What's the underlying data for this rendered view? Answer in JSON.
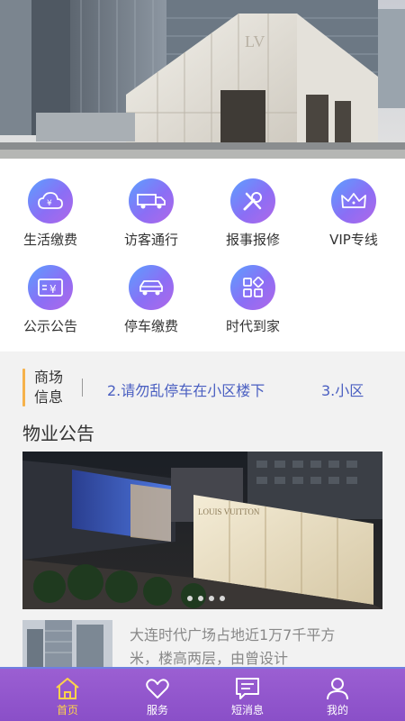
{
  "services": [
    {
      "label": "生活缴费",
      "icon": "cloud-yen-icon"
    },
    {
      "label": "访客通行",
      "icon": "truck-icon"
    },
    {
      "label": "报事报修",
      "icon": "tools-icon"
    },
    {
      "label": "VIP专线",
      "icon": "crown-icon"
    },
    {
      "label": "公示公告",
      "icon": "yen-card-icon"
    },
    {
      "label": "停车缴费",
      "icon": "car-icon"
    },
    {
      "label": "时代到家",
      "icon": "apps-icon"
    }
  ],
  "news": {
    "label_line1": "商场",
    "label_line2": "信息",
    "item1": "2.请勿乱停车在小区楼下",
    "item2": "3.小区"
  },
  "section_title": "物业公告",
  "article": {
    "text": "大连时代广场占地近1万7千平方米，楼高两层，由曾设计"
  },
  "carousel": {
    "dots": 4
  },
  "tabs": [
    {
      "label": "首页",
      "icon": "home-icon",
      "active": true
    },
    {
      "label": "服务",
      "icon": "heart-chat-icon",
      "active": false
    },
    {
      "label": "短消息",
      "icon": "message-icon",
      "active": false
    },
    {
      "label": "我的",
      "icon": "user-icon",
      "active": false
    }
  ],
  "colors": {
    "accent": "#8a4fc8",
    "active_tab": "#ffd34a",
    "news_link": "#4a5fc1",
    "news_bar": "#f6b24b"
  }
}
